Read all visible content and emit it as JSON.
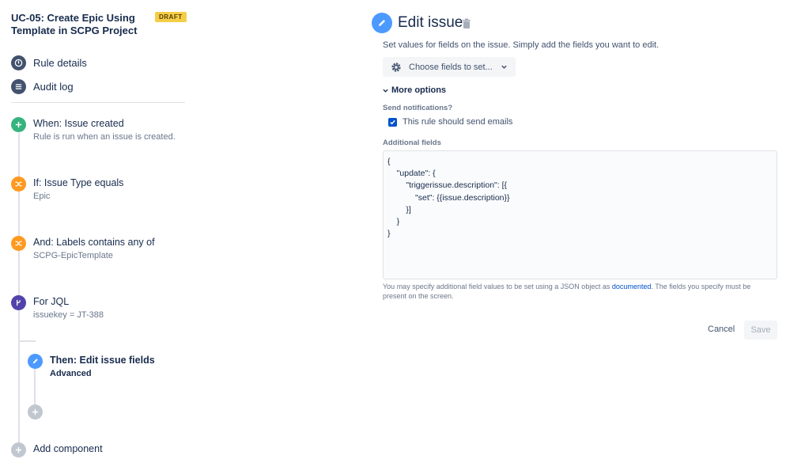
{
  "rule": {
    "title": "UC-05: Create Epic Using Template in SCPG Project",
    "status_badge": "DRAFT"
  },
  "nav": {
    "rule_details": "Rule details",
    "audit_log": "Audit log"
  },
  "steps": [
    {
      "title": "When: Issue created",
      "subtitle": "Rule is run when an issue is created.",
      "color": "#36b37e",
      "icon": "plus-icon"
    },
    {
      "title": "If: Issue Type equals",
      "subtitle": "Epic",
      "color": "#ff991f",
      "icon": "shuffle-icon"
    },
    {
      "title": "And: Labels contains any of",
      "subtitle": "SCPG-EpicTemplate",
      "color": "#ff991f",
      "icon": "shuffle-icon"
    },
    {
      "title": "For JQL",
      "subtitle": "issuekey = JT-388",
      "color": "#5243aa",
      "icon": "branch-icon"
    },
    {
      "title": "Then: Edit issue fields",
      "subtitle": "Advanced",
      "color": "#4c9aff",
      "icon": "pencil-icon"
    }
  ],
  "add_component": "Add component",
  "editor": {
    "title": "Edit issue",
    "description": "Set values for fields on the issue. Simply add the fields you want to edit.",
    "choose_fields": "Choose fields to set...",
    "more_options": "More options",
    "send_notifications_label": "Send notifications?",
    "send_emails_checkbox": "This rule should send emails",
    "send_emails_checked": true,
    "additional_fields_label": "Additional fields",
    "json_value": "{\n    \"update\": {\n        \"triggerissue.description\": [{\n            \"set\": {{issue.description}}\n        }]\n    }\n}",
    "help_before": "You may specify additional field values to be set using a JSON object as ",
    "help_link": "documented",
    "help_after": ". The fields you specify must be present on the screen.",
    "cancel": "Cancel",
    "save": "Save"
  }
}
